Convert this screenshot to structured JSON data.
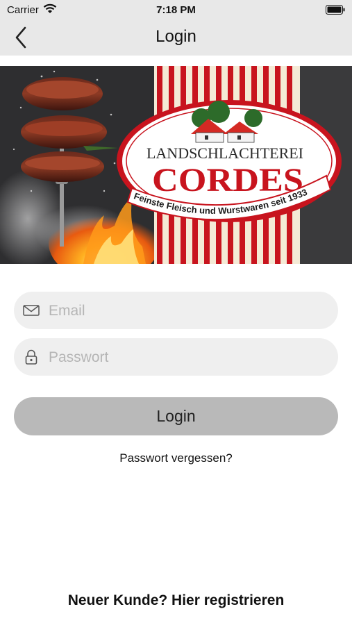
{
  "status_bar": {
    "carrier": "Carrier",
    "time": "7:18 PM"
  },
  "nav": {
    "title": "Login",
    "back_icon": "chevron-left-icon"
  },
  "banner": {
    "brand_line1": "LANDSCHLACHTEREI",
    "brand_line2": "CORDES",
    "tagline": "Feinste Fleisch und Wurstwaren seit 1933"
  },
  "form": {
    "email_placeholder": "Email",
    "email_icon": "envelope-icon",
    "password_placeholder": "Passwort",
    "password_icon": "lock-icon",
    "login_label": "Login",
    "forgot_label": "Passwort vergessen?"
  },
  "footer": {
    "register_label": "Neuer Kunde? Hier registrieren"
  },
  "colors": {
    "nav_bg": "#e8e8e8",
    "brand_red": "#c8141e",
    "field_bg": "#efefef",
    "button_bg": "#b9b9b9"
  }
}
